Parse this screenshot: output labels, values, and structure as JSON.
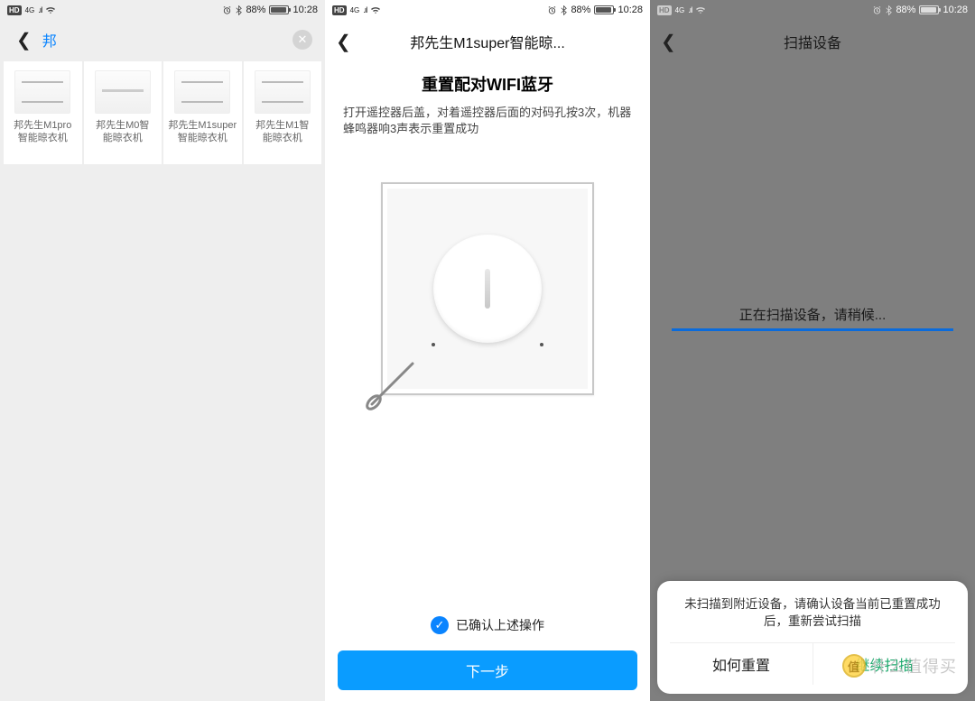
{
  "status": {
    "hd": "HD",
    "net": "4G",
    "signal": ".ıl",
    "alarm_icon": "alarm",
    "bt_icon": "bluetooth",
    "battery_pct": "88%",
    "time": "10:28"
  },
  "left": {
    "search_value": "邦",
    "products": [
      {
        "label": "邦先生M1pro\n智能晾衣机"
      },
      {
        "label": "邦先生M0智\n能晾衣机"
      },
      {
        "label": "邦先生M1super\n智能晾衣机"
      },
      {
        "label": "邦先生M1智\n能晾衣机"
      }
    ]
  },
  "mid": {
    "title": "邦先生M1super智能晾...",
    "heading": "重置配对WIFI蓝牙",
    "desc": "打开遥控器后盖，对着遥控器后面的对码孔按3次，机器蜂鸣器响3声表示重置成功",
    "confirm_label": "已确认上述操作",
    "next_label": "下一步"
  },
  "right": {
    "title": "扫描设备",
    "scanning": "正在扫描设备，请稍候...",
    "sheet_msg": "未扫描到附近设备，请确认设备当前已重置成功后，重新尝试扫描",
    "btn_reset": "如何重置",
    "btn_continue": "继续扫描"
  },
  "watermark": {
    "coin": "值",
    "text": "什么值得买"
  }
}
